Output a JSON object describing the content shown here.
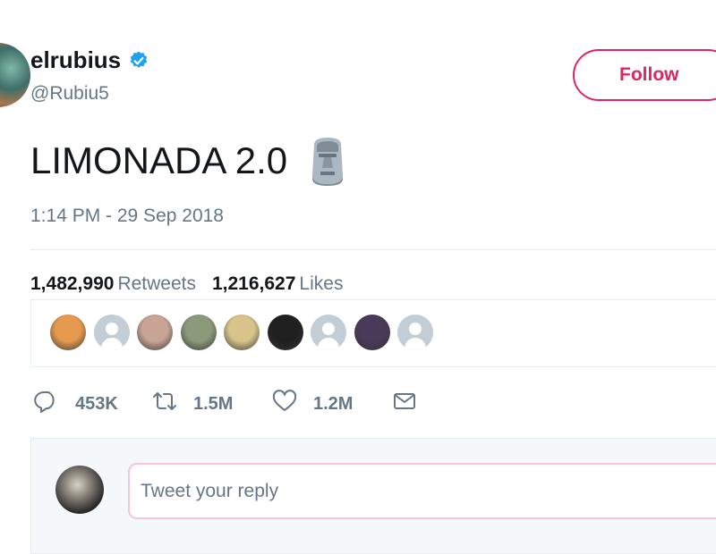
{
  "author": {
    "name": "elrubius",
    "handle": "@Rubiu5",
    "verified": true
  },
  "follow_label": "Follow",
  "tweet": {
    "text": "LIMONADA 2.0",
    "emoji_icon": "moai-icon",
    "timestamp": "1:14 PM - 29 Sep 2018"
  },
  "stats": {
    "retweets_count": "1,482,990",
    "retweets_label": "Retweets",
    "likes_count": "1,216,627",
    "likes_label": "Likes"
  },
  "likers": [
    {
      "avatar": "photo",
      "color": "#e69a4f"
    },
    {
      "avatar": "default"
    },
    {
      "avatar": "photo",
      "color": "#c9a596"
    },
    {
      "avatar": "photo",
      "color": "#8a9a7a"
    },
    {
      "avatar": "photo",
      "color": "#d8c48a"
    },
    {
      "avatar": "photo",
      "color": "#1f1f1f"
    },
    {
      "avatar": "default"
    },
    {
      "avatar": "photo",
      "color": "#4a3a5a"
    },
    {
      "avatar": "default"
    }
  ],
  "actions": {
    "replies": "453K",
    "retweets": "1.5M",
    "likes": "1.2M"
  },
  "reply": {
    "placeholder": "Tweet your reply"
  },
  "colors": {
    "accent": "#e0245e",
    "verified": "#1da1f2",
    "secondary_text": "#657786"
  }
}
